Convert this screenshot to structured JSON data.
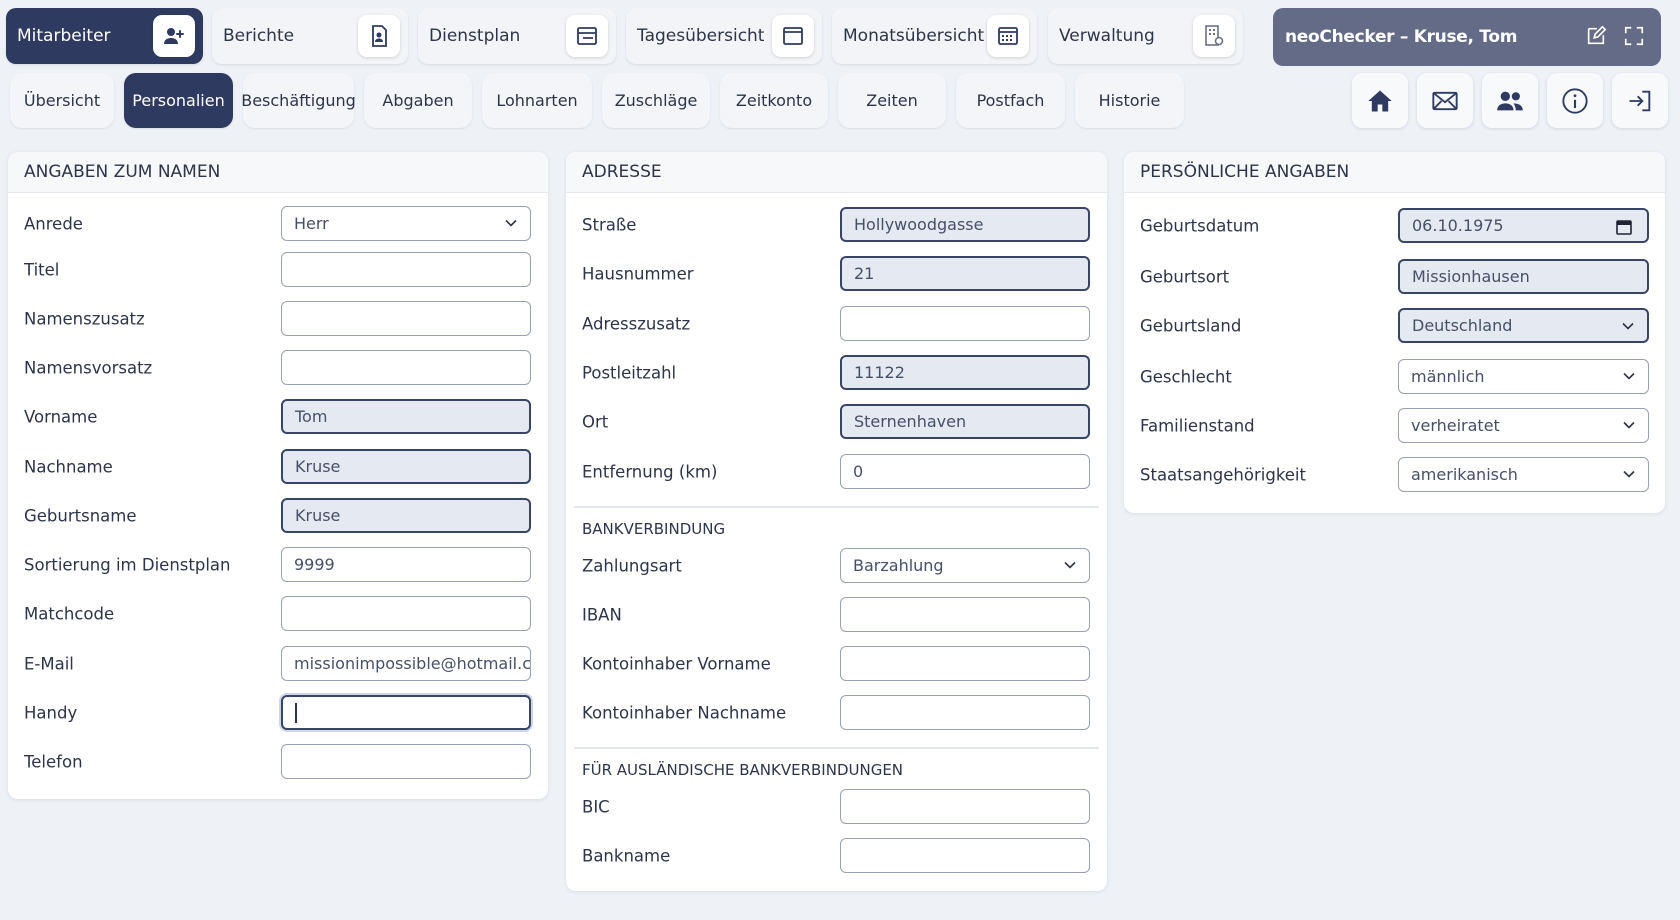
{
  "topnav": {
    "items": [
      {
        "label": "Mitarbeiter"
      },
      {
        "label": "Berichte"
      },
      {
        "label": "Dienstplan"
      },
      {
        "label": "Tagesübersicht"
      },
      {
        "label": "Monatsübersicht"
      },
      {
        "label": "Verwaltung"
      }
    ],
    "app_title": "neoChecker – Kruse, Tom"
  },
  "subtabs": [
    {
      "label": "Übersicht"
    },
    {
      "label": "Personalien"
    },
    {
      "label": "Beschäftigung"
    },
    {
      "label": "Abgaben"
    },
    {
      "label": "Lohnarten"
    },
    {
      "label": "Zuschläge"
    },
    {
      "label": "Zeitkonto"
    },
    {
      "label": "Zeiten"
    },
    {
      "label": "Postfach"
    },
    {
      "label": "Historie"
    }
  ],
  "colors": {
    "primary": "#2e3a5f",
    "title_bar": "#646b86",
    "background": "#eef2f7"
  },
  "name_panel": {
    "title": "ANGABEN ZUM NAMEN",
    "fields": [
      {
        "label": "Anrede",
        "value": "Herr"
      },
      {
        "label": "Titel",
        "value": ""
      },
      {
        "label": "Namenszusatz",
        "value": ""
      },
      {
        "label": "Namensvorsatz",
        "value": ""
      },
      {
        "label": "Vorname",
        "value": "Tom"
      },
      {
        "label": "Nachname",
        "value": "Kruse"
      },
      {
        "label": "Geburtsname",
        "value": "Kruse"
      },
      {
        "label": "Sortierung im Dienstplan",
        "value": "9999"
      },
      {
        "label": "Matchcode",
        "value": ""
      },
      {
        "label": "E-Mail",
        "value": "missionimpossible@hotmail.com"
      },
      {
        "label": "Handy",
        "value": ""
      },
      {
        "label": "Telefon",
        "value": ""
      }
    ]
  },
  "address_panel": {
    "title": "ADRESSE",
    "fields": [
      {
        "label": "Straße",
        "value": "Hollywoodgasse"
      },
      {
        "label": "Hausnummer",
        "value": "21"
      },
      {
        "label": "Adresszusatz",
        "value": ""
      },
      {
        "label": "Postleitzahl",
        "value": "11122"
      },
      {
        "label": "Ort",
        "value": "Sternenhaven"
      },
      {
        "label": "Entfernung (km)",
        "value": "0"
      }
    ],
    "bank_heading": "BANKVERBINDUNG",
    "bank_fields": [
      {
        "label": "Zahlungsart",
        "value": "Barzahlung"
      },
      {
        "label": "IBAN",
        "value": ""
      },
      {
        "label": "Kontoinhaber Vorname",
        "value": ""
      },
      {
        "label": "Kontoinhaber Nachname",
        "value": ""
      }
    ],
    "foreign_heading": "FÜR AUSLÄNDISCHE BANKVERBINDUNGEN",
    "foreign_fields": [
      {
        "label": "BIC",
        "value": ""
      },
      {
        "label": "Bankname",
        "value": ""
      }
    ]
  },
  "personal_panel": {
    "title": "PERSÖNLICHE ANGABEN",
    "fields": [
      {
        "label": "Geburtsdatum",
        "value": "06.10.1975"
      },
      {
        "label": "Geburtsort",
        "value": "Missionhausen"
      },
      {
        "label": "Geburtsland",
        "value": "Deutschland"
      },
      {
        "label": "Geschlecht",
        "value": "männlich"
      },
      {
        "label": "Familienstand",
        "value": "verheiratet"
      },
      {
        "label": "Staatsangehörigkeit",
        "value": "amerikanisch"
      }
    ]
  }
}
